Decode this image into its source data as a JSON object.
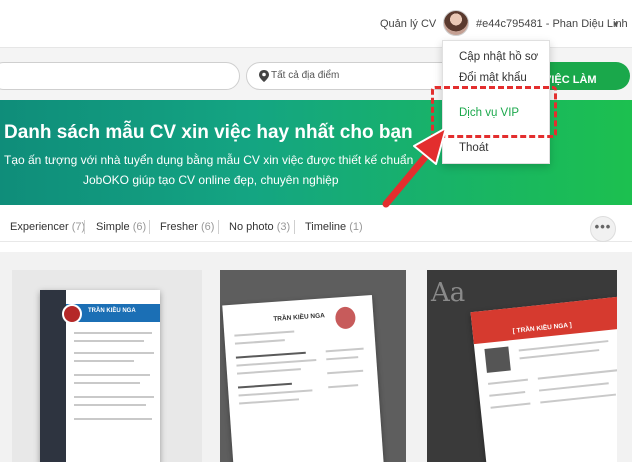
{
  "header": {
    "manage_cv": "Quản lý CV",
    "user_label": "#e44c795481 - Phan Diệu Linh"
  },
  "search": {
    "location_placeholder": "Tất cả địa điểm",
    "button_label": "VIỆC LÀM"
  },
  "hero": {
    "title": "Danh sách mẫu CV xin việc hay nhất cho bạn",
    "line1": "Tạo ấn tượng với nhà tuyển dụng bằng mẫu CV xin việc được thiết kế chuẩn",
    "line2": "JobOKO giúp tạo CV online đẹp, chuyên nghiệp"
  },
  "filters": [
    {
      "label": "Experiencer",
      "count": "(7)"
    },
    {
      "label": "Simple",
      "count": "(6)"
    },
    {
      "label": "Fresher",
      "count": "(6)"
    },
    {
      "label": "No photo",
      "count": "(3)"
    },
    {
      "label": "Timeline",
      "count": "(1)"
    }
  ],
  "more_label": "•••",
  "dropdown": {
    "items": [
      "Cập nhật hồ sơ",
      "Đổi mật khẩu",
      "Dịch vụ VIP",
      "Thoát"
    ]
  },
  "cards": [
    {
      "name": "TRẦN KIỀU NGA"
    },
    {
      "name": "TRẦN KIỀU NGA"
    },
    {
      "name": "[ TRẦN KIỀU NGA ]"
    }
  ],
  "colors": {
    "accent_green": "#1aa84b",
    "highlight_red": "#e32e2e"
  }
}
